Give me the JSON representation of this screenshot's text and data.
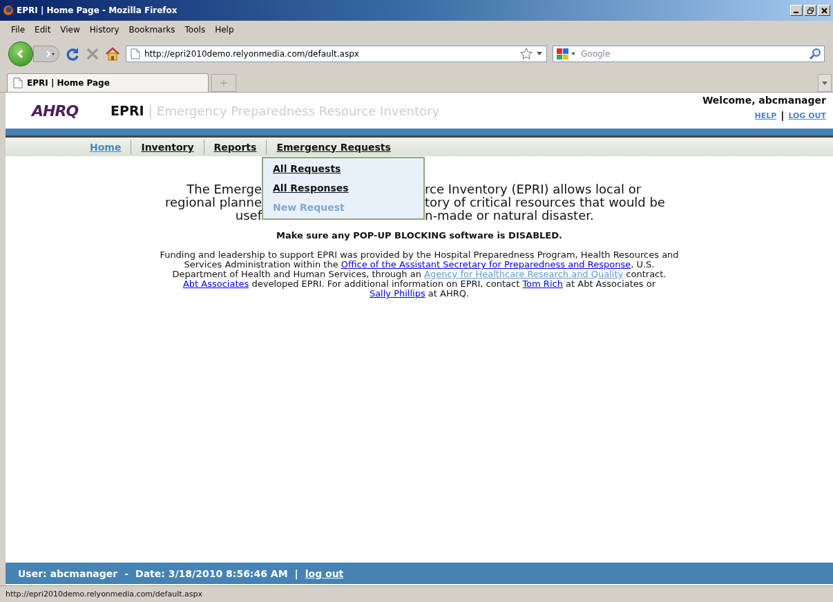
{
  "window": {
    "title": "EPRI | Home Page - Mozilla Firefox"
  },
  "menu": [
    "File",
    "Edit",
    "View",
    "History",
    "Bookmarks",
    "Tools",
    "Help"
  ],
  "toolbar": {
    "url": "http://epri2010demo.relyonmedia.com/default.aspx",
    "search": {
      "placeholder": "Google"
    }
  },
  "tabs": [
    {
      "label": "EPRI | Home Page",
      "selected": true
    }
  ],
  "header": {
    "logo": "AHRQ",
    "site_name": "EPRI",
    "separator": "|",
    "subtitle": "Emergency Preparedness Resource Inventory",
    "welcome": "Welcome, abcmanager",
    "links": [
      "HELP",
      "LOG OUT"
    ],
    "link_separator": "|"
  },
  "nav": [
    {
      "label": "Home",
      "selected": true
    },
    {
      "label": "Inventory",
      "selected": false
    },
    {
      "label": "Reports",
      "selected": false
    },
    {
      "label": "Emergency Requests",
      "selected": false
    }
  ],
  "dropdown": [
    {
      "label": "All Requests",
      "disabled": false
    },
    {
      "label": "All Responses",
      "disabled": false
    },
    {
      "label": "New Request",
      "disabled": true
    }
  ],
  "intro_lines": [
    {
      "left": "The Emerge",
      "right": "rce Inventory (EPRI) allows local or"
    },
    {
      "left": "regional planne",
      "right": "tory of critical resources that would be"
    },
    {
      "left": "usef",
      "right": "n-made or natural disaster."
    }
  ],
  "notice": "Make sure any POP-UP BLOCKING software is DISABLED.",
  "funding": [
    {
      "kind": "text",
      "text": "Funding and leadership to support EPRI was provided by the Hospital Preparedness Program, Health Resources and Services Administration within the "
    },
    {
      "kind": "link",
      "text": "Office of the Assistant Secretary for Preparedness and Response",
      "visited": false
    },
    {
      "kind": "text",
      "text": ", U.S. Department of Health and Human Services, through an "
    },
    {
      "kind": "link",
      "text": "Agency for Healthcare Research and Quality",
      "visited": true
    },
    {
      "kind": "text",
      "text": " contract. "
    },
    {
      "kind": "link",
      "text": "Abt Associates",
      "visited": false
    },
    {
      "kind": "text",
      "text": " developed EPRI. For additional information on EPRI, contact "
    },
    {
      "kind": "link",
      "text": "Tom Rich",
      "visited": false
    },
    {
      "kind": "text",
      "text": " at Abt Associates or "
    },
    {
      "kind": "link",
      "text": "Sally Phillips",
      "visited": false
    },
    {
      "kind": "text",
      "text": " at AHRQ."
    }
  ],
  "footer": {
    "user": "User: abcmanager",
    "dash": "-",
    "date": "Date: 3/18/2010 8:56:46 AM",
    "separator": "|",
    "logout": "log out"
  },
  "status_bar": {
    "text": "http://epri2010demo.relyonmedia.com/default.aspx"
  }
}
